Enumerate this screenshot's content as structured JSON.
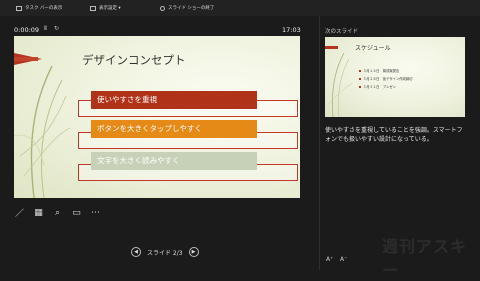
{
  "toolbar": {
    "items": [
      "タスク バーの表示",
      "表示設定 ▾",
      "スライド ショーの終了"
    ]
  },
  "presenter": {
    "elapsed": "0:00:09",
    "pause_glyph": "Ⅱ",
    "reset_glyph": "↻",
    "clock": "17:03"
  },
  "slide": {
    "title": "デザインコンセプト",
    "bullets": [
      "使いやすさを重視",
      "ボタンを大きくタップしやすく",
      "文字を大きく読みやすく"
    ],
    "colors": {
      "accent_red": "#b03219",
      "accent_orange": "#e58a17",
      "accent_gray": "#c7d1b7"
    }
  },
  "tools": {
    "icons": [
      "pen-icon",
      "slides-grid-icon",
      "zoom-icon",
      "screen-icon",
      "more-icon"
    ],
    "glyphs": [
      "／",
      "▦",
      "⌕",
      "▭",
      "⋯"
    ]
  },
  "nav": {
    "prev_glyph": "◀",
    "label": "スライド 2/3",
    "next_glyph": "▶"
  },
  "next": {
    "label": "次のスライド",
    "title": "スケジュール",
    "items": [
      "３月１４日　構成案提出",
      "３月２８日　仮デザイン作成締切",
      "３月３１日　プレゼン"
    ]
  },
  "notes": {
    "text": "使いやすさを重視していることを強調。スマートフォンでも扱いやすい設計になっている。"
  },
  "font_controls": {
    "increase": "A⁺",
    "decrease": "A⁻"
  },
  "watermark": "週刊アスキー"
}
